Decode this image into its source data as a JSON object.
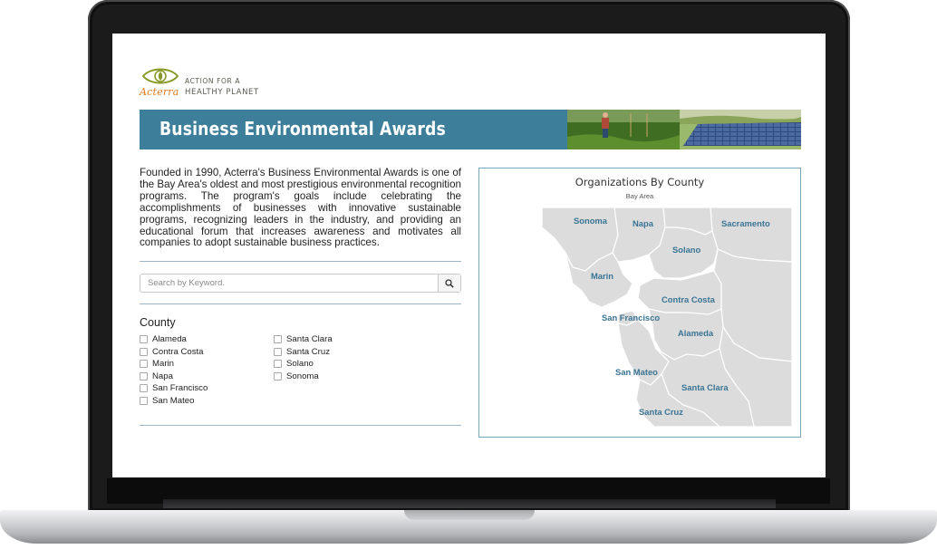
{
  "logo": {
    "name": "Acterra",
    "tagline_line1": "ACTION FOR A",
    "tagline_line2": "HEALTHY PLANET"
  },
  "banner": {
    "title": "Business Environmental Awards"
  },
  "intro": {
    "text": "Founded in 1990, Acterra's Business Environmental Awards is one of the Bay Area's oldest and most prestigious environmental recognition programs. The program's goals include celebrating the accomplishments of businesses with innovative sustainable programs, recognizing leaders in the industry, and providing an educational forum that increases awareness and motivates all companies to adopt sustainable business practices."
  },
  "search": {
    "placeholder": "Search by Keyword.",
    "value": "",
    "icon": "search-icon"
  },
  "county_filter": {
    "heading": "County",
    "column1": [
      "Alameda",
      "Contra Costa",
      "Marin",
      "Napa",
      "San Francisco",
      "San Mateo"
    ],
    "column2": [
      "Santa Clara",
      "Santa Cruz",
      "Solano",
      "Sonoma"
    ]
  },
  "map": {
    "title": "Organizations By County",
    "subtitle": "Bay Area",
    "labels": {
      "sonoma": "Sonoma",
      "napa": "Napa",
      "sacramento": "Sacramento",
      "solano": "Solano",
      "marin": "Marin",
      "contra_costa": "Contra Costa",
      "san_francisco": "San Francisco",
      "alameda": "Alameda",
      "san_mateo": "San Mateo",
      "santa_clara": "Santa Clara",
      "santa_cruz": "Santa Cruz"
    }
  },
  "colors": {
    "banner": "#3d7f9a",
    "accent_orange": "#e07a1f",
    "county_label": "#3a7494",
    "map_land": "#dcdcdc",
    "map_border": "#ffffff"
  }
}
